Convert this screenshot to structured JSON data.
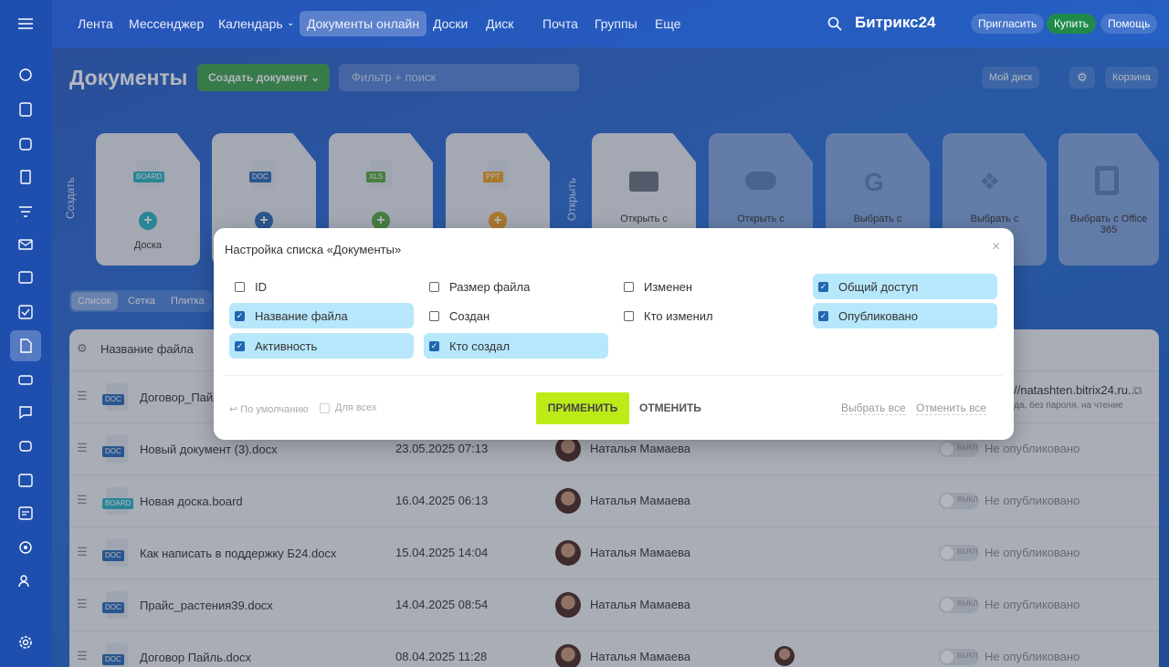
{
  "topbar": {
    "nav": [
      "Лента",
      "Мессенджер",
      "Календарь",
      "Документы онлайн",
      "Доски",
      "Диск",
      "Почта",
      "Группы",
      "Еще"
    ],
    "logo": "Битрикс24",
    "invite": "Пригласить",
    "buy": "Купить",
    "help": "Помощь"
  },
  "page": {
    "title": "Документы",
    "create_button": "Создать документ",
    "search_placeholder": "Фильтр + поиск",
    "my_disk": "Мой диск",
    "trash": "Корзина"
  },
  "create_section": {
    "label": "Создать",
    "tiles": [
      {
        "label": "Доска",
        "tag": "BOARD",
        "color": "#2bb3c0"
      },
      {
        "label": "",
        "tag": "DOC",
        "color": "#2c6bb5"
      },
      {
        "label": "",
        "tag": "XLS",
        "color": "#56a83c"
      },
      {
        "label": "",
        "tag": "PPT",
        "color": "#f0a020"
      }
    ]
  },
  "open_section": {
    "label": "Открыть",
    "tiles": [
      "Открыть с",
      "Открыть с",
      "Выбрать с",
      "Выбрать с",
      "Выбрать с Office 365"
    ]
  },
  "views": [
    "Список",
    "Сетка",
    "Плитка"
  ],
  "table": {
    "header": "Название файла",
    "rows": [
      {
        "name": "Договор_Пайль",
        "date": "",
        "author": "",
        "status": "",
        "link": "//natashten.bitrix24.ru...",
        "link_note": "да, без пароля, на чтение"
      },
      {
        "name": "Новый документ (3).docx",
        "date": "23.05.2025 07:13",
        "author": "Наталья Мамаева",
        "status": "Не опубликовано",
        "tag": "DOC"
      },
      {
        "name": "Новая доска.board",
        "date": "16.04.2025 06:13",
        "author": "Наталья Мамаева",
        "status": "Не опубликовано",
        "tag": "BOARD"
      },
      {
        "name": "Как написать в поддержку Б24.docx",
        "date": "15.04.2025 14:04",
        "author": "Наталья Мамаева",
        "status": "Не опубликовано",
        "tag": "DOC"
      },
      {
        "name": "Прайс_растения39.docx",
        "date": "14.04.2025 08:54",
        "author": "Наталья Мамаева",
        "status": "Не опубликовано",
        "tag": "DOC"
      },
      {
        "name": "Договор Пайль.docx",
        "date": "08.04.2025 11:28",
        "author": "Наталья Мамаева",
        "status": "Не опубликовано",
        "tag": "DOC"
      }
    ],
    "toggle_off": "ВЫКЛ"
  },
  "modal": {
    "title": "Настройка списка «Документы»",
    "options": [
      {
        "label": "ID",
        "checked": false
      },
      {
        "label": "Размер файла",
        "checked": false
      },
      {
        "label": "Изменен",
        "checked": false
      },
      {
        "label": "Общий доступ",
        "checked": true
      },
      {
        "label": "Название файла",
        "checked": true
      },
      {
        "label": "Создан",
        "checked": false
      },
      {
        "label": "Кто изменил",
        "checked": false
      },
      {
        "label": "Опубликовано",
        "checked": true
      },
      {
        "label": "Активность",
        "checked": true
      },
      {
        "label": "Кто создал",
        "checked": true
      }
    ],
    "default": "По умолчанию",
    "for_all": "Для всех",
    "apply": "ПРИМЕНИТЬ",
    "cancel": "ОТМЕНИТЬ",
    "select_all": "Выбрать все",
    "deselect_all": "Отменить все"
  },
  "colors": {
    "accent_green": "#bdeb18",
    "checked_bg": "#b7e7fb",
    "buy": "#1f8a4c"
  }
}
